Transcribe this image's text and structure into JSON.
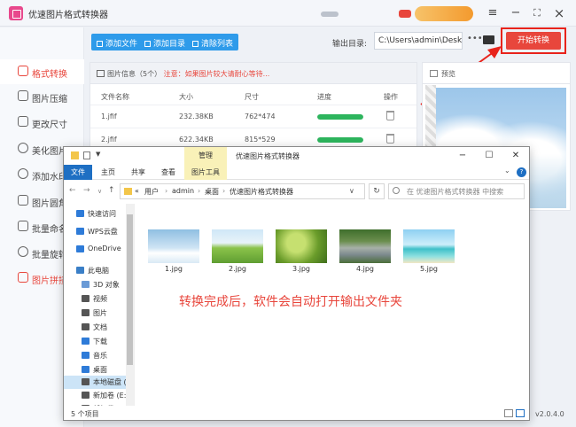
{
  "app": {
    "title": "优速图片格式转换器",
    "window_controls": {
      "menu": "≡",
      "minimize": "−",
      "maximize": "⛶",
      "close": "×"
    }
  },
  "sidebar": {
    "items": [
      {
        "label": "格式转换",
        "active": true
      },
      {
        "label": "图片压缩"
      },
      {
        "label": "更改尺寸"
      },
      {
        "label": "美化图片"
      },
      {
        "label": "添加水印"
      },
      {
        "label": "图片圆角"
      },
      {
        "label": "批量命名"
      },
      {
        "label": "批量旋转"
      },
      {
        "label": "图片拼接"
      }
    ]
  },
  "toolbar": {
    "add_file": "添加文件",
    "add_folder": "添加目录",
    "clear_list": "清除列表",
    "output_label": "输出目录:",
    "output_path": "C:\\Users\\admin\\Deskto",
    "browse": "•••",
    "start": "开始转换"
  },
  "file_list": {
    "info": "图片信息（5个）",
    "warning": "注意：如果图片较大请耐心等待...",
    "headers": {
      "name": "文件名称",
      "size": "大小",
      "dimension": "尺寸",
      "progress": "进度",
      "action": "操作"
    },
    "rows": [
      {
        "name": "1.jfif",
        "size": "232.38KB",
        "dimension": "762*474",
        "progress": 1.0
      },
      {
        "name": "2.jfif",
        "size": "622.34KB",
        "dimension": "815*529",
        "progress": 1.0
      }
    ]
  },
  "preview": {
    "label": "预览"
  },
  "version": "v2.0.4.0",
  "explorer": {
    "title": "优速图片格式转换器",
    "manage_tab": "管理",
    "ribbon_tabs": [
      "文件",
      "主页",
      "共享",
      "查看",
      "图片工具"
    ],
    "breadcrumb": [
      "«",
      "用户",
      "admin",
      "桌面",
      "优速图片格式转换器"
    ],
    "search_placeholder": "在 优速图片格式转换器 中搜索",
    "nav_items": [
      {
        "label": "快速访问",
        "color": "#2e7bd8"
      },
      {
        "label": "WPS云盘",
        "color": "#2e7bd8"
      },
      {
        "label": "OneDrive",
        "color": "#2e7bd8"
      },
      {
        "label": "此电脑",
        "color": "#3a7fc7"
      },
      {
        "label": "3D 对象",
        "color": "#6a9ad6",
        "sub": true
      },
      {
        "label": "视频",
        "color": "#555",
        "sub": true
      },
      {
        "label": "图片",
        "color": "#555",
        "sub": true
      },
      {
        "label": "文档",
        "color": "#555",
        "sub": true
      },
      {
        "label": "下载",
        "color": "#2e7bd8",
        "sub": true
      },
      {
        "label": "音乐",
        "color": "#2e7bd8",
        "sub": true
      },
      {
        "label": "桌面",
        "color": "#2e7bd8",
        "sub": true
      },
      {
        "label": "本地磁盘 (C",
        "color": "#555",
        "sub": true,
        "selected": true
      },
      {
        "label": "新加卷 (E:)",
        "color": "#555",
        "sub": true
      },
      {
        "label": "新加卷 (F:)",
        "color": "#555",
        "sub": true
      }
    ],
    "files": [
      {
        "name": "1.jpg",
        "theme": "sky"
      },
      {
        "name": "2.jpg",
        "theme": "meadow"
      },
      {
        "name": "3.jpg",
        "theme": "leaves"
      },
      {
        "name": "4.jpg",
        "theme": "river"
      },
      {
        "name": "5.jpg",
        "theme": "beach"
      }
    ],
    "hint": "转换完成后，软件会自动打开输出文件夹",
    "status": "5 个项目"
  }
}
